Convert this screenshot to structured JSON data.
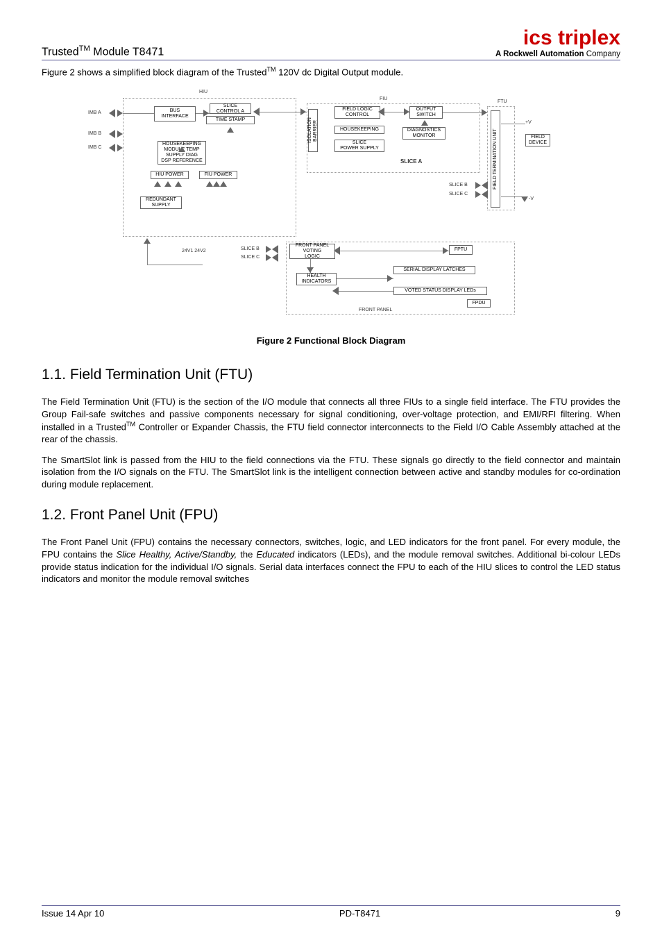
{
  "header": {
    "left_prefix": "Trusted",
    "left_tm": "TM",
    "left_suffix": " Module T8471",
    "logo_main": "ics triplex",
    "logo_sub_bold": "A Rockwell Automation",
    "logo_sub_plain": " Company"
  },
  "intro": {
    "pre": "Figure 2 shows a simplified block diagram of the Trusted",
    "tm": "TM",
    "post": " 120V dc Digital Output module."
  },
  "diagram": {
    "hiu": "HIU",
    "fiu": "FIU",
    "ftu": "FTU",
    "imb_a": "IMB A",
    "imb_b": "IMB B",
    "imb_c": "IMB C",
    "bus_interface": "BUS\nINTERFACE",
    "slice_control_a": "SLICE\nCONTROL A",
    "time_stamp": "TIME STAMP",
    "housekeeping_etc": "HOUSEKEEPING\nMODULE TEMP\nSUPPLY DIAG\nDSP REFERENCE",
    "hiu_power": "HIU POWER",
    "fiu_power": "FIU POWER",
    "redundant_supply": "REDUNDANT\nSUPPLY",
    "v24": "24V1   24V2",
    "slice_b": "SLICE B",
    "slice_c": "SLICE C",
    "isolation_barrier": "ISOLATION\nBARRIER",
    "field_logic_control": "FIELD LOGIC\nCONTROL",
    "housekeeping": "HOUSEKEEPING",
    "slice_power_supply": "SLICE\nPOWER SUPPLY",
    "output_switch": "OUTPUT\nSWITCH",
    "diagnostics_monitor": "DIAGNOSTICS\nMONITOR",
    "slice_a": "SLICE A",
    "field_termination_unit": "FIELD TERMINATION UNIT",
    "field_device": "FIELD\nDEVICE",
    "plus_v": "+V",
    "minus_v": "-V",
    "front_panel_voting_logic": "FRONT PANEL\nVOTING\nLOGIC",
    "health_indicators": "HEALTH\nINDICATORS",
    "fptu": "FPTU",
    "serial_display_latches": "SERIAL DISPLAY LATCHES",
    "voted_status_display_leds": "VOTED STATUS DISPLAY LEDs",
    "fpdu": "FPDU",
    "front_panel": "FRONT PANEL"
  },
  "figure_caption": "Figure 2 Functional Block Diagram",
  "section1": {
    "heading": "1.1. Field Termination Unit (FTU)",
    "p1_pre": "The Field Termination Unit (FTU) is the section of the I/O module that connects all three FIUs to a single field interface.  The FTU provides the Group Fail-safe switches and passive components necessary for signal conditioning, over-voltage protection, and EMI/RFI filtering.  When installed in a Trusted",
    "p1_tm": "TM",
    "p1_post": " Controller or Expander Chassis, the FTU field connector interconnects to the Field I/O Cable Assembly attached at the rear of the chassis.",
    "p2": "The SmartSlot link is passed from the HIU to the field connections via the FTU.  These signals go directly to the field connector and maintain isolation from the I/O signals on the FTU.  The SmartSlot link is the intelligent connection between active and standby modules for co-ordination during module replacement."
  },
  "section2": {
    "heading": "1.2. Front Panel Unit (FPU)",
    "p1_a": "The Front Panel Unit (FPU) contains the necessary connectors, switches, logic, and LED indicators for the front panel.  For every module, the FPU contains the ",
    "p1_i1": "Slice Healthy, Active/Standby,",
    "p1_b": " the ",
    "p1_i2": "Educated",
    "p1_c": " indicators (LEDs), and the module removal switches.  Additional bi-colour LEDs provide status indication for the individual I/O signals.  Serial data interfaces connect the FPU to each of the HIU slices to control the LED status indicators and monitor the module removal switches"
  },
  "footer": {
    "left": "Issue 14 Apr 10",
    "center": "PD-T8471",
    "right": "9"
  }
}
